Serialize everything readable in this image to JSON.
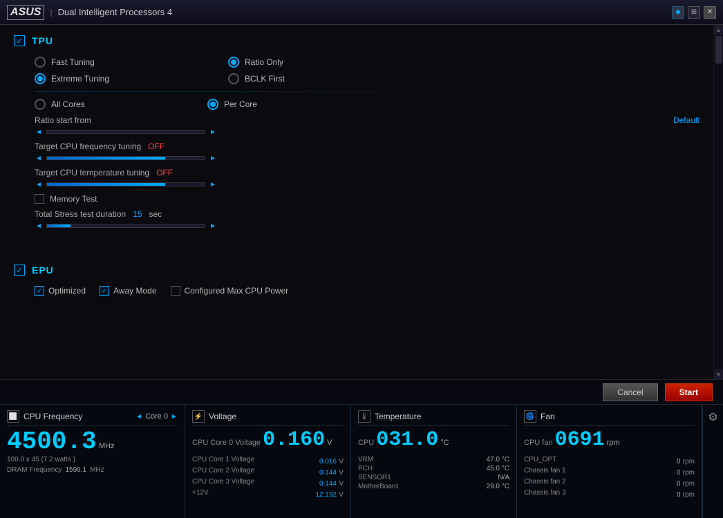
{
  "titleBar": {
    "logo": "ASUS",
    "title": "Dual Intelligent Processors 4"
  },
  "tpu": {
    "sectionName": "TPU",
    "checked": true,
    "tuningOptions": [
      {
        "id": "fast",
        "label": "Fast Tuning",
        "selected": false
      },
      {
        "id": "extreme",
        "label": "Extreme Tuning",
        "selected": true
      }
    ],
    "ratioOptions": [
      {
        "id": "ratio",
        "label": "Ratio Only",
        "selected": true
      },
      {
        "id": "bclk",
        "label": "BCLK First",
        "selected": false
      }
    ],
    "coreOptions": [
      {
        "id": "allcores",
        "label": "All Cores",
        "selected": false
      },
      {
        "id": "percore",
        "label": "Per Core",
        "selected": true
      }
    ],
    "ratioStartFrom": "Ratio start from",
    "ratioDefault": "Default",
    "targetCpuFreq": "Target CPU frequency tuning",
    "targetCpuFreqVal": "OFF",
    "targetCpuTemp": "Target CPU temperature tuning",
    "targetCpuTempVal": "OFF",
    "memoryTest": "Memory Test",
    "stressLabel": "Total Stress test duration",
    "stressValue": "15",
    "stressUnit": "sec"
  },
  "epu": {
    "sectionName": "EPU",
    "checked": true,
    "options": [
      {
        "id": "optimized",
        "label": "Optimized",
        "checked": true
      },
      {
        "id": "away",
        "label": "Away Mode",
        "checked": true
      }
    ],
    "configuredMaxCpu": "Configured Max CPU Power"
  },
  "actionBar": {
    "cancelLabel": "Cancel",
    "startLabel": "Start"
  },
  "statusPanels": {
    "cpu": {
      "title": "CPU Frequency",
      "coreLabel": "Core 0",
      "freqValue": "4500.3",
      "freqUnit": "MHz",
      "subInfo": "100.0 x 45  (7.2   watts )",
      "dramLabel": "DRAM Frequency",
      "dramValue": "1596.1",
      "dramUnit": "MHz"
    },
    "voltage": {
      "title": "Voltage",
      "mainLabel": "CPU Core 0 Voltage",
      "mainValue": "0.160",
      "mainUnit": "V",
      "items": [
        {
          "label": "CPU Core 1 Voltage",
          "value": "0.016",
          "unit": "V"
        },
        {
          "label": "CPU Core 2 Voltage",
          "value": "0.144",
          "unit": "V"
        },
        {
          "label": "CPU Core 3 Voltage",
          "value": "0.144",
          "unit": "V"
        },
        {
          "label": "+12V",
          "value": "12.192",
          "unit": "V"
        }
      ]
    },
    "temperature": {
      "title": "Temperature",
      "mainLabel": "CPU",
      "mainValue": "031.0",
      "mainUnit": "°C",
      "items": [
        {
          "label": "VRM",
          "value": "47.0 °C"
        },
        {
          "label": "PCH",
          "value": "45.0 °C"
        },
        {
          "label": "SENSOR1",
          "value": "N/A"
        },
        {
          "label": "MotherBoard",
          "value": "29.0 °C"
        }
      ]
    },
    "fan": {
      "title": "Fan",
      "mainLabel": "CPU fan",
      "mainValue": "0691",
      "mainUnit": "rpm",
      "items": [
        {
          "label": "CPU_OPT",
          "value": "0",
          "unit": "rpm"
        },
        {
          "label": "Chassis fan 1",
          "value": "0",
          "unit": "rpm"
        },
        {
          "label": "Chassis fan 2",
          "value": "0",
          "unit": "rpm"
        },
        {
          "label": "Chassis fan 3",
          "value": "0",
          "unit": "rpm"
        }
      ]
    }
  }
}
